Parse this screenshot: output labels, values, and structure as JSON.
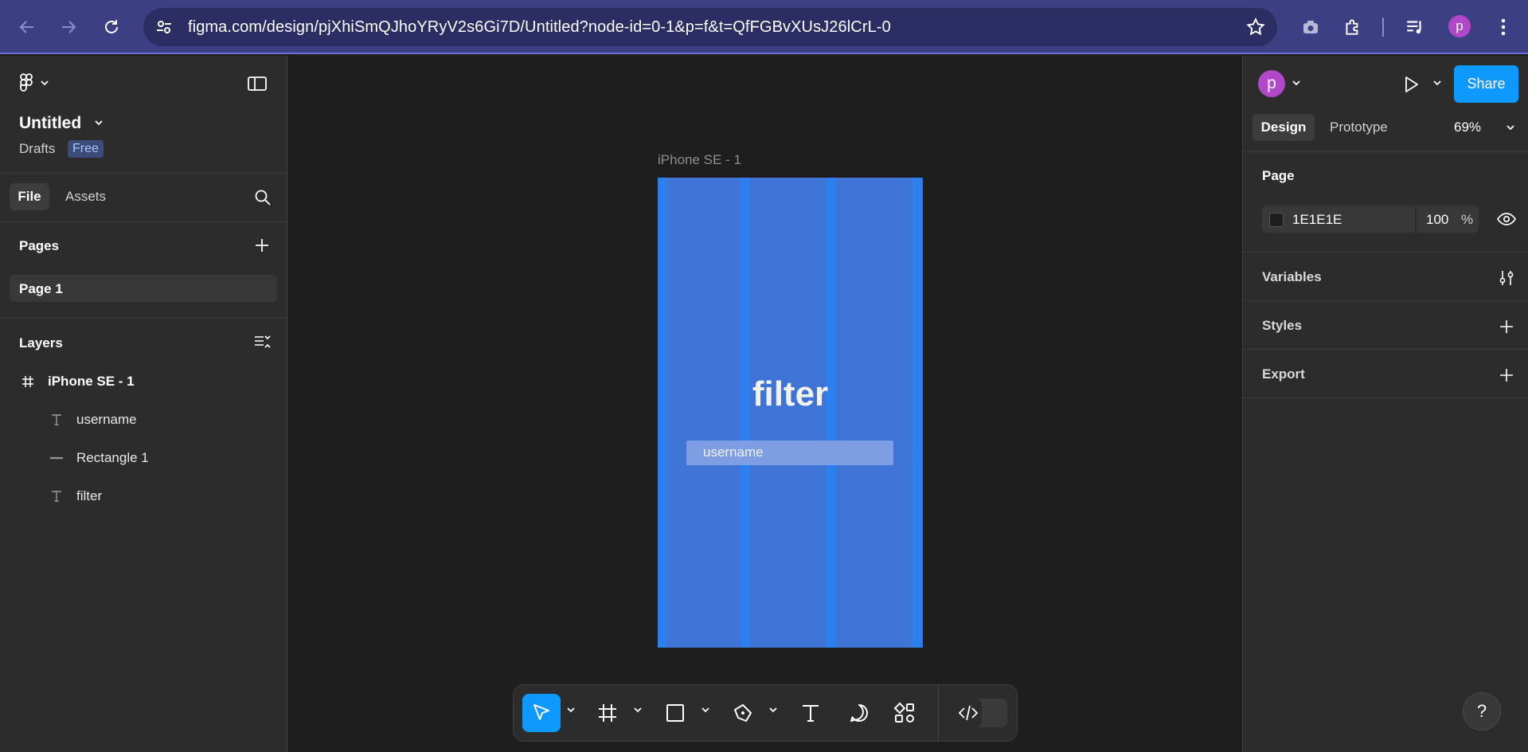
{
  "browser": {
    "url": "figma.com/design/pjXhiSmQJhoYRyV2s6Gi7D/Untitled?node-id=0-1&p=f&t=QfFGBvXUsJ26lCrL-0",
    "profile_initial": "p",
    "colors": {
      "chrome": "#3c3f84",
      "urlbar": "#2b2d63",
      "profile": "#b147c9"
    }
  },
  "left_panel": {
    "file_name": "Untitled",
    "location": "Drafts",
    "plan_badge": "Free",
    "tabs": {
      "file": "File",
      "assets": "Assets"
    },
    "pages_title": "Pages",
    "pages": [
      {
        "label": "Page 1"
      }
    ],
    "layers_title": "Layers",
    "layers": [
      {
        "label": "iPhone SE - 1",
        "icon": "frame-icon"
      },
      {
        "label": "username",
        "icon": "text-icon"
      },
      {
        "label": "Rectangle 1",
        "icon": "line-icon"
      },
      {
        "label": "filter",
        "icon": "text-icon"
      }
    ]
  },
  "canvas": {
    "frame_label": "iPhone SE - 1",
    "frame_title": "filter",
    "input_placeholder": "username",
    "colors": {
      "frame": "#3f74d7",
      "grid_column": "#2b7ff0",
      "input": "#7d9ee3"
    }
  },
  "toolbar": {
    "tools": [
      "move-tool",
      "frame-tool",
      "shape-tool",
      "pen-tool",
      "text-tool",
      "comment-tool",
      "actions-tool",
      "dev-mode-toggle"
    ],
    "active_tool": "move-tool",
    "accent": "#0d99ff"
  },
  "right_panel": {
    "avatar_initial": "p",
    "share_label": "Share",
    "tabs": {
      "design": "Design",
      "prototype": "Prototype"
    },
    "zoom": "69%",
    "page_section": "Page",
    "page_color_hex": "1E1E1E",
    "page_opacity": "100",
    "page_opacity_unit": "%",
    "variables_label": "Variables",
    "styles_label": "Styles",
    "export_label": "Export"
  },
  "help_label": "?"
}
